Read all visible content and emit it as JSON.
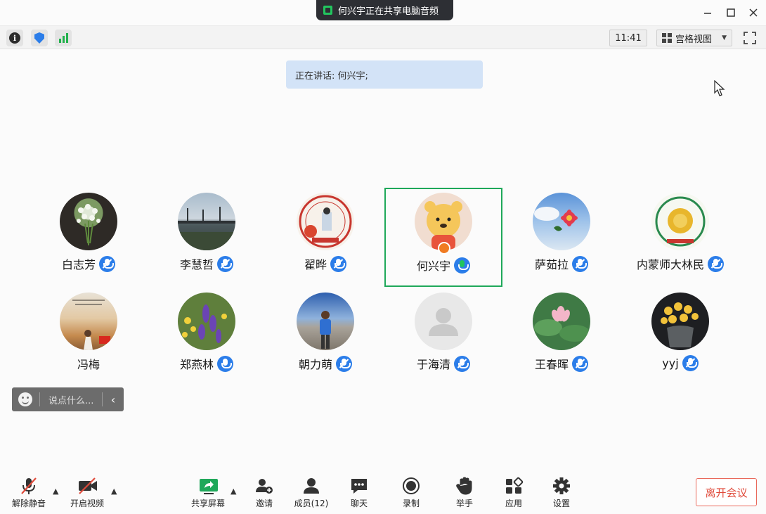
{
  "title_bar": {
    "share_notice": "何兴宇正在共享电脑音频"
  },
  "toolbar": {
    "clock": "11:41",
    "view_mode": "宫格视图"
  },
  "speaking_banner": "正在讲话: 何兴宇;",
  "participants": [
    {
      "name": "白志芳",
      "mic": "muted"
    },
    {
      "name": "李慧哲",
      "mic": "muted"
    },
    {
      "name": "翟晔",
      "mic": "muted"
    },
    {
      "name": "何兴宇",
      "mic": "talking",
      "active": true
    },
    {
      "name": "萨茹拉",
      "mic": "muted"
    },
    {
      "name": "内蒙师大林民",
      "mic": "muted"
    },
    {
      "name": "冯梅",
      "mic": "none"
    },
    {
      "name": "郑燕林",
      "mic": "on"
    },
    {
      "name": "朝力萌",
      "mic": "muted"
    },
    {
      "name": "于海清",
      "mic": "muted"
    },
    {
      "name": "王春晖",
      "mic": "muted"
    },
    {
      "name": "yyj",
      "mic": "muted"
    }
  ],
  "chat": {
    "placeholder": "说点什么..."
  },
  "bottom_bar": {
    "unmute": "解除静音",
    "start_video": "开启视频",
    "share_screen": "共享屏幕",
    "invite": "邀请",
    "members": "成员(12)",
    "chat": "聊天",
    "record": "录制",
    "raise_hand": "举手",
    "apps": "应用",
    "settings": "设置",
    "leave": "离开会议"
  },
  "colors": {
    "accent_blue": "#2b7de9",
    "active_green": "#1fa85a",
    "leave_red": "#e04a3a",
    "speaking_bg": "#d3e3f7"
  }
}
